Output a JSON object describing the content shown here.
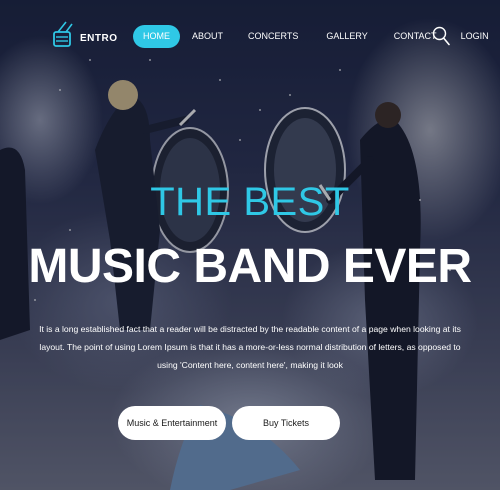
{
  "brand": {
    "name": "ENTRO"
  },
  "nav": {
    "items": [
      {
        "label": "HOME",
        "active": true
      },
      {
        "label": "ABOUT"
      },
      {
        "label": "CONCERTS"
      },
      {
        "label": "GALLERY"
      },
      {
        "label": "CONTACT"
      },
      {
        "label": "LOGIN"
      }
    ]
  },
  "hero": {
    "kicker": "THE BEST",
    "headline": "MUSIC BAND EVER",
    "description": "It is a long established fact that a reader will be distracted by the readable content of a page when looking at its layout. The point of using Lorem Ipsum is that it has a more-or-less normal distribution of letters, as opposed to using 'Content here, content here', making it look",
    "buttons": [
      {
        "label": "Music & Entertainment"
      },
      {
        "label": "Buy Tickets"
      }
    ]
  },
  "colors": {
    "accent": "#2fc8e6",
    "button_bg": "#ffffff",
    "text": "#ffffff"
  },
  "icons": {
    "logo": "drum-logo-icon",
    "search": "search-icon"
  }
}
